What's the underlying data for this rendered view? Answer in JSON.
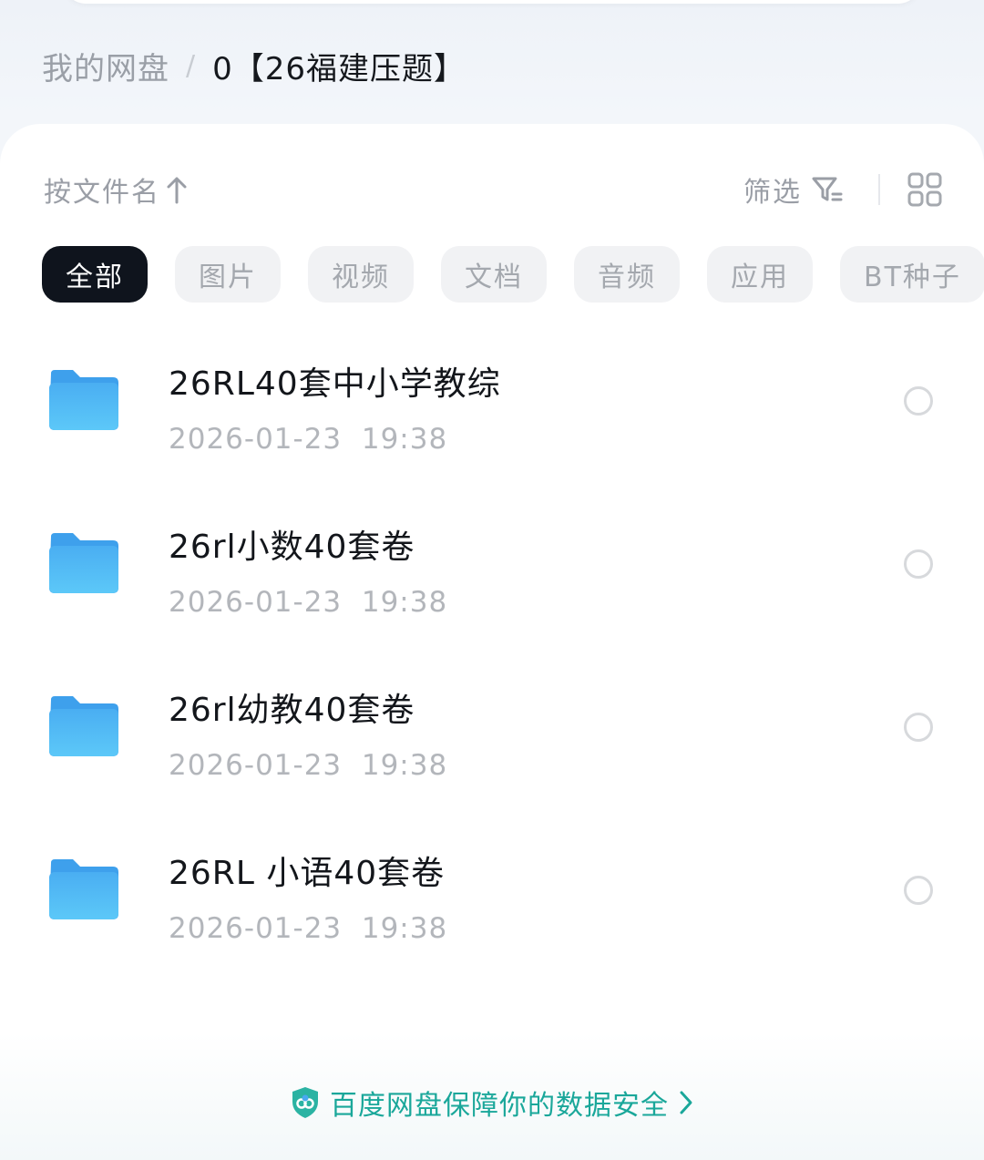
{
  "breadcrumb": {
    "root": "我的网盘",
    "separator": "/",
    "current": "0【26福建压题】"
  },
  "toolbar": {
    "sort_label": "按文件名",
    "sort_icon": "arrow-up-icon",
    "filter_label": "筛选",
    "filter_icon": "filter-icon",
    "view_icon": "grid-view-icon"
  },
  "chips": [
    {
      "label": "全部",
      "active": true
    },
    {
      "label": "图片",
      "active": false
    },
    {
      "label": "视频",
      "active": false
    },
    {
      "label": "文档",
      "active": false
    },
    {
      "label": "音频",
      "active": false
    },
    {
      "label": "应用",
      "active": false
    },
    {
      "label": "BT种子",
      "active": false
    }
  ],
  "files": [
    {
      "name": "26RL40套中小学教综",
      "date": "2026-01-23  19:38",
      "type": "folder"
    },
    {
      "name": "26rl小数40套卷",
      "date": "2026-01-23  19:38",
      "type": "folder"
    },
    {
      "name": "26rl幼教40套卷",
      "date": "2026-01-23  19:38",
      "type": "folder"
    },
    {
      "name": "26RL 小语40套卷",
      "date": "2026-01-23  19:38",
      "type": "folder"
    }
  ],
  "footer": {
    "security_text": "百度网盘保障你的数据安全",
    "icon": "shield-icon",
    "chevron_icon": "chevron-right-icon"
  },
  "colors": {
    "accent_teal": "#1aa79a",
    "chip_active_bg": "#0f141d",
    "folder_blue": "#4cb8f5"
  }
}
